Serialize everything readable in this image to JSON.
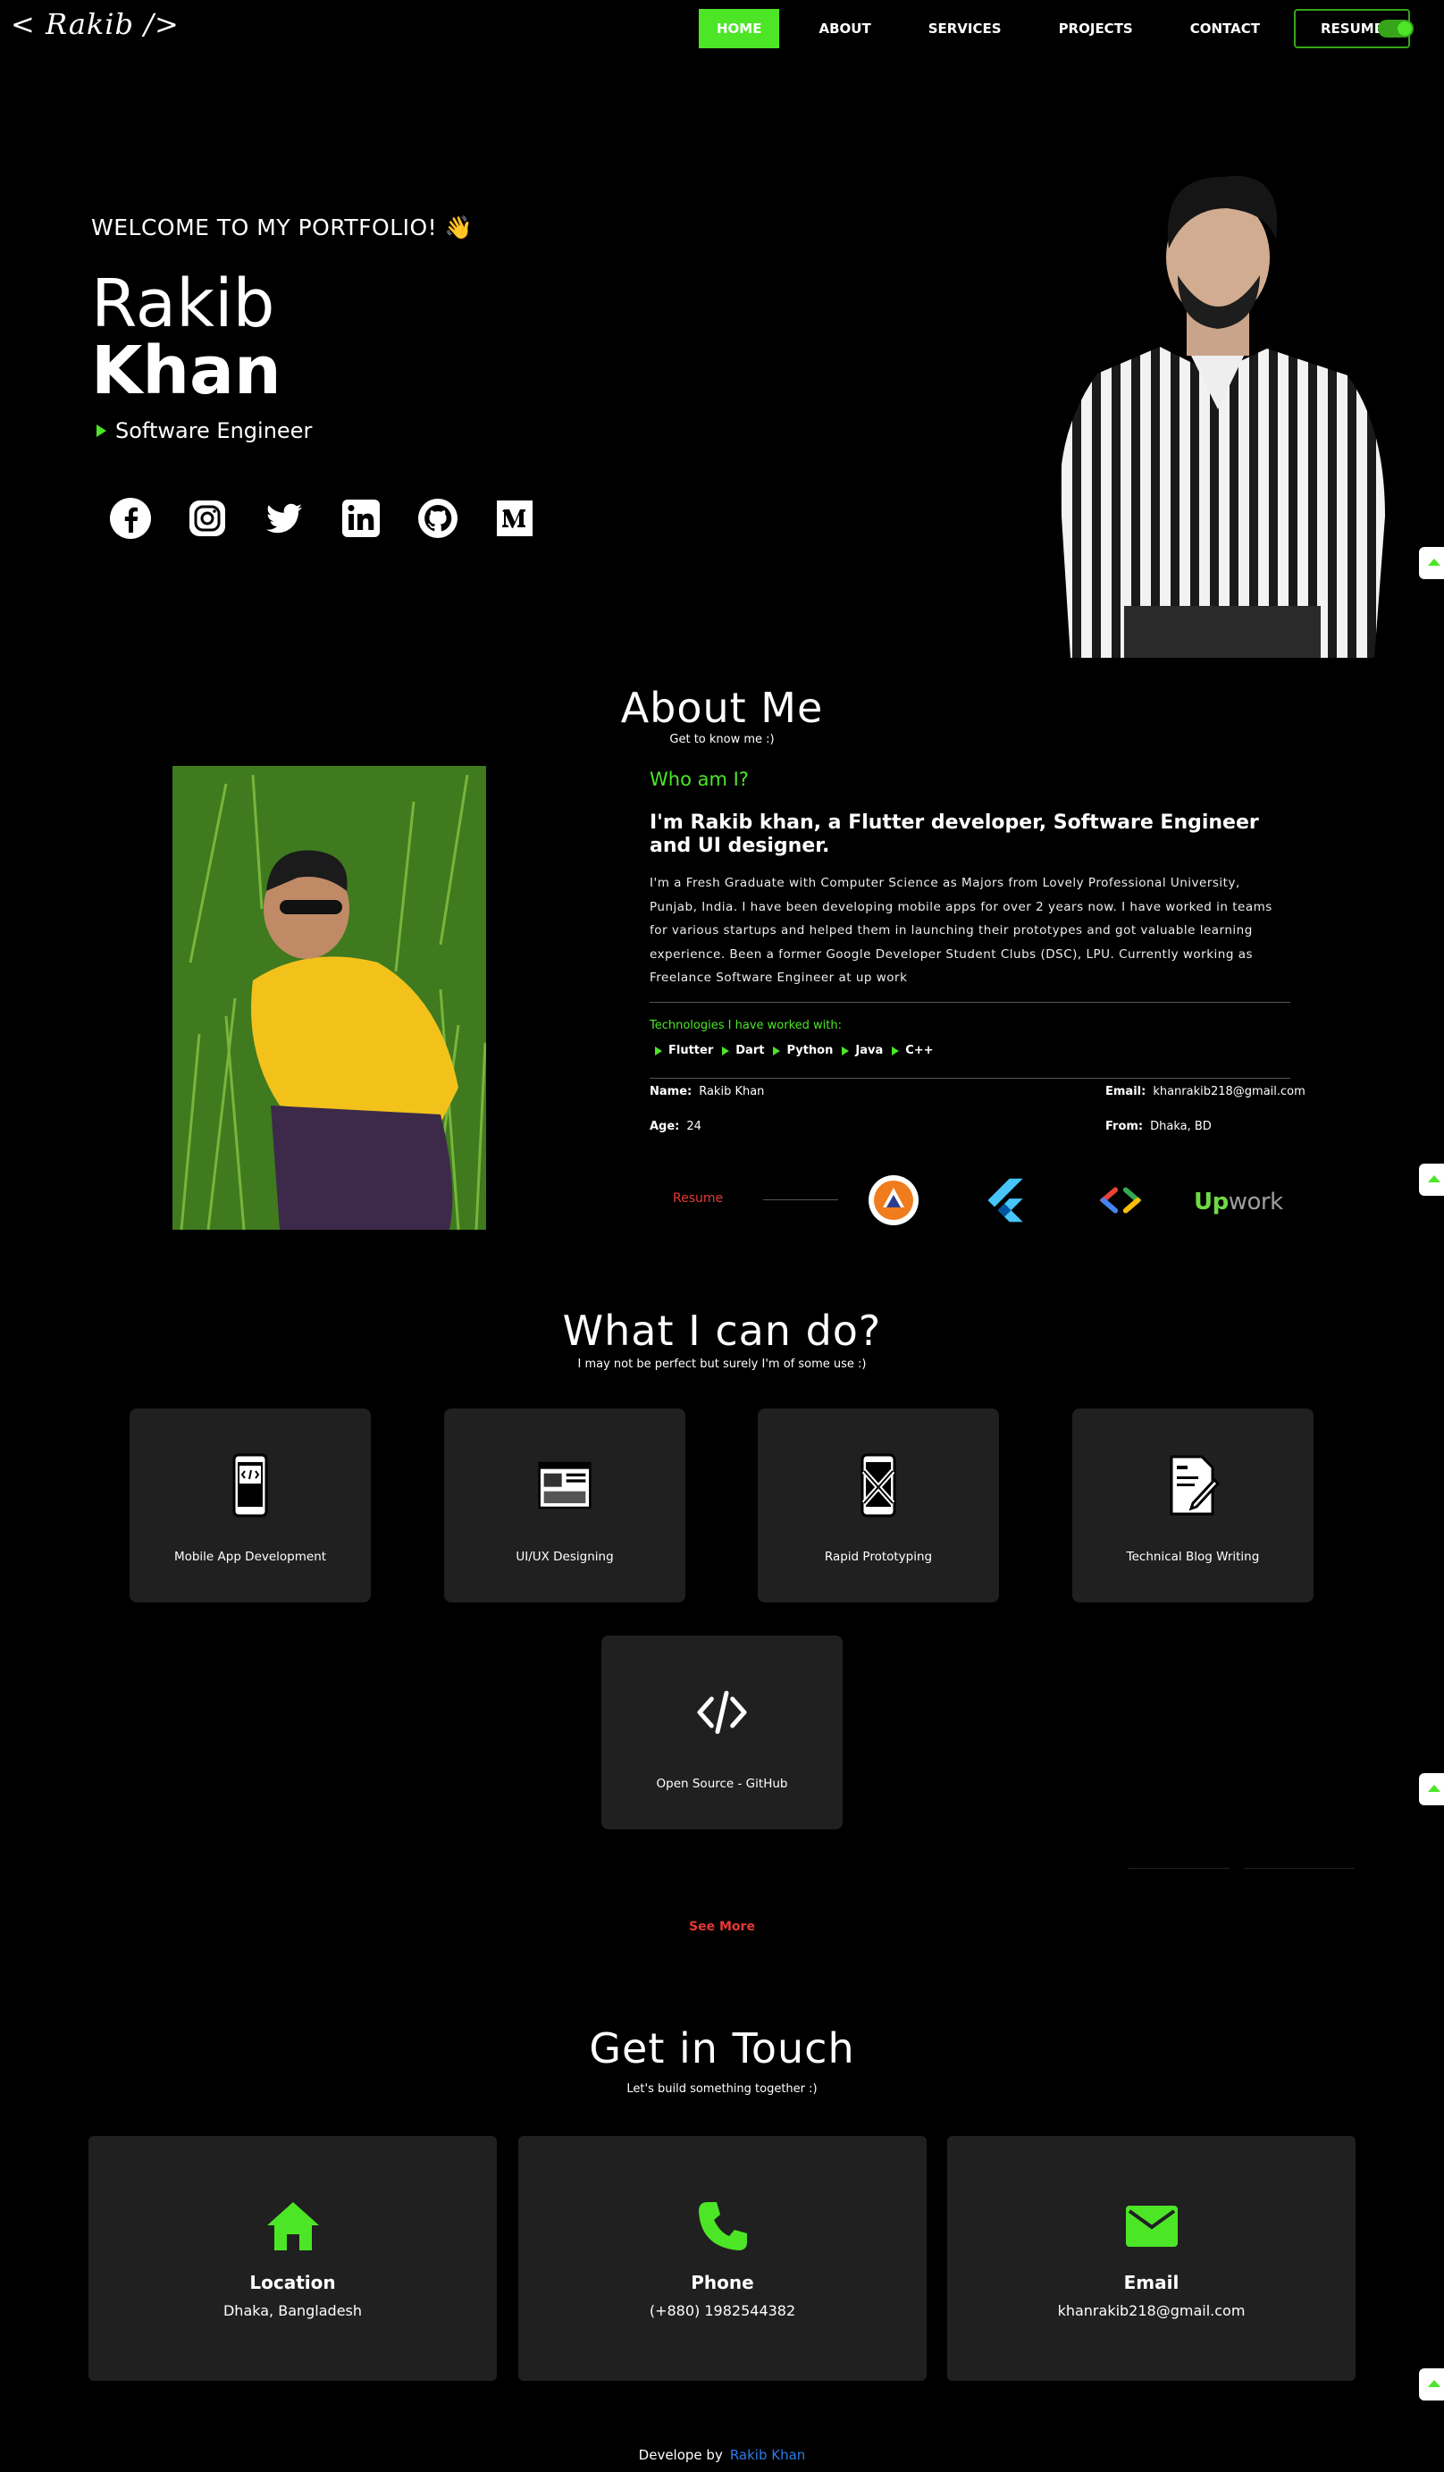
{
  "nav": {
    "logo": "< Rakib />",
    "links": [
      "HOME",
      "ABOUT",
      "SERVICES",
      "PROJECTS",
      "CONTACT"
    ],
    "resume": "RESUME"
  },
  "hero": {
    "welcome": "WELCOME TO MY PORTFOLIO! 👋",
    "first_name": "Rakib",
    "last_name": "Khan",
    "role": "Software Engineer",
    "socials": [
      "facebook-icon",
      "instagram-icon",
      "twitter-icon",
      "linkedin-icon",
      "github-icon",
      "medium-icon"
    ]
  },
  "about": {
    "title": "About Me",
    "subtitle": "Get to know me :)",
    "who": "Who am I?",
    "heading": "I'm Rakib khan, a Flutter developer, Software Engineer and UI designer.",
    "paragraph": "I'm a Fresh Graduate with Computer Science as Majors from Lovely Professional University, Punjab, India. I have been developing mobile apps for over 2 years now. I have worked in teams for various startups and helped them in launching their prototypes and got valuable learning experience. Been a former  Google Developer Student Clubs (DSC), LPU. Currently working as Freelance Software Engineer at up work",
    "tech_title": "Technologies I have worked with:",
    "tech": [
      "Flutter",
      "Dart",
      "Python",
      "Java",
      "C++"
    ],
    "info": {
      "name_label": "Name:",
      "name": "Rakib Khan",
      "email_label": "Email:",
      "email": "khanrakib218@gmail.com",
      "age_label": "Age:",
      "age": "24",
      "from_label": "From:",
      "from": "Dhaka, BD"
    },
    "resume_link": "Resume",
    "upwork_a": "Up",
    "upwork_b": "work"
  },
  "services": {
    "title": "What I can do?",
    "subtitle": "I may not be perfect but surely I'm of some use :)",
    "cards": [
      {
        "label": "Mobile App Development",
        "icon": "mobile-code-icon"
      },
      {
        "label": "UI/UX Designing",
        "icon": "ui-design-icon"
      },
      {
        "label": "Rapid Prototyping",
        "icon": "prototype-icon"
      },
      {
        "label": "Technical Blog Writing",
        "icon": "blog-writing-icon"
      },
      {
        "label": "Open Source - GitHub",
        "icon": "code-icon"
      }
    ],
    "see_more": "See More"
  },
  "contact": {
    "title": "Get in Touch",
    "subtitle": "Let's build something together :)",
    "cards": [
      {
        "title": "Location",
        "value": "Dhaka, Bangladesh"
      },
      {
        "title": "Phone",
        "value": "(+880) 1982544382"
      },
      {
        "title": "Email",
        "value": "khanrakib218@gmail.com"
      }
    ]
  },
  "footer": {
    "text": "Develope by",
    "link": "Rakib Khan"
  },
  "colors": {
    "accent": "#4ce627",
    "background": "#000000",
    "card": "#202020",
    "danger": "#e53935",
    "link": "#2f7be5"
  }
}
